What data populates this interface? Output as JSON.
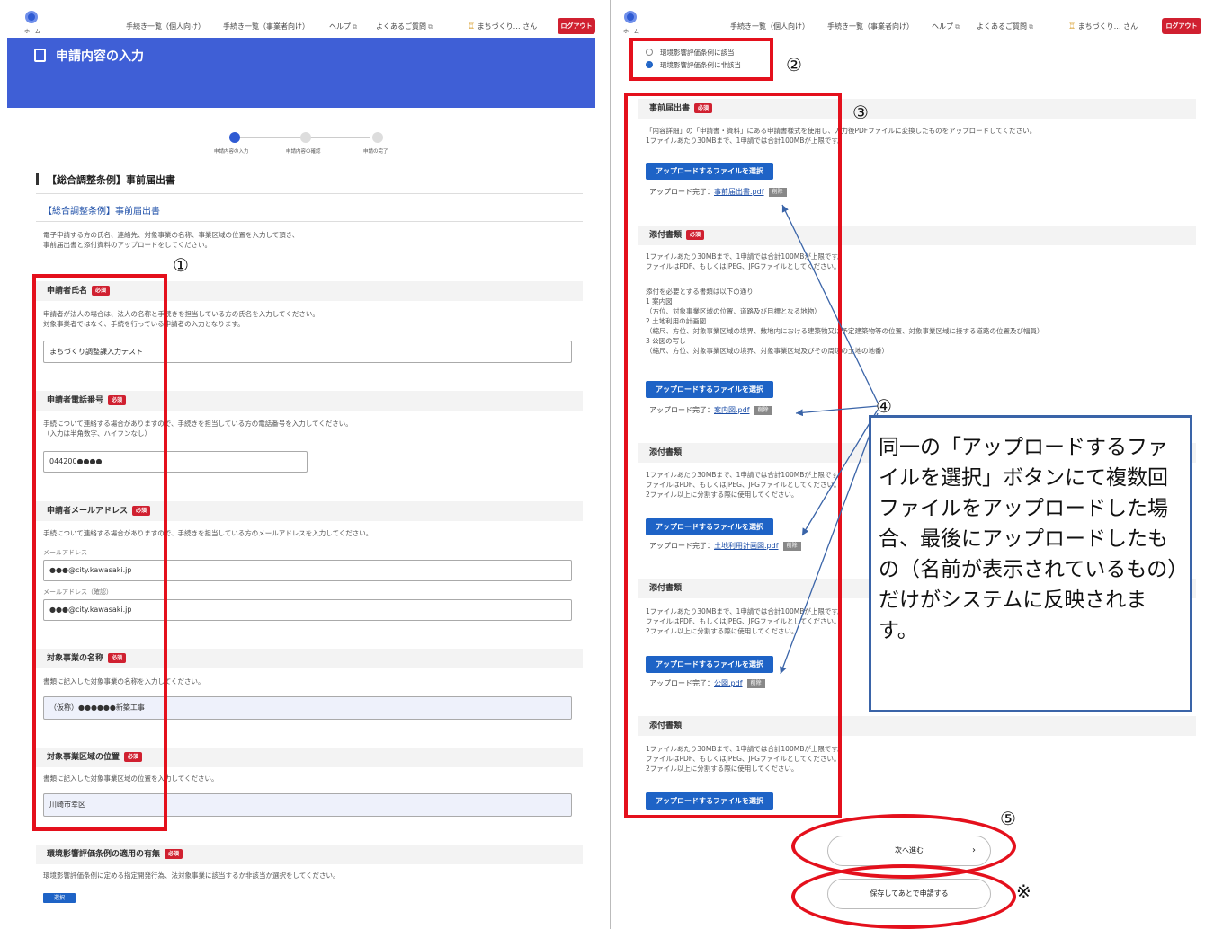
{
  "header": {
    "home_label": "ホーム",
    "links": [
      "手続き一覧（個人向け）",
      "手続き一覧（事業者向け）",
      "ヘルプ",
      "よくあるご質問"
    ],
    "user": "まちづくり… さん",
    "logout": "ログアウト"
  },
  "left": {
    "page_title": "申請内容の入力",
    "steps": [
      "申請内容の入力",
      "申請内容の確認",
      "申請の完了"
    ],
    "form_title": "【総合調整条例】事前届出書",
    "sub_title": "【総合調整条例】事前届出書",
    "intro": "電子申請する方の氏名、連絡先、対象事業の名称、事業区域の位置を入力して頂き、\n事前届出書と添付資料のアップロードをしてください。",
    "fields": [
      {
        "label": "申請者氏名",
        "help": "申請者が法人の場合は、法人の名称と手続きを担当している方の氏名を入力してください。\n対象事業者ではなく、手続を行っている申請者の入力となります。",
        "value": "まちづくり調整課入力テスト"
      },
      {
        "label": "申請者電話番号",
        "help": "手続について連絡する場合がありますので、手続きを担当している方の電話番号を入力してください。\n（入力は半角数字、ハイフンなし）",
        "value": "044200●●●●"
      },
      {
        "label": "申請者メールアドレス",
        "help": "手続について連絡する場合がありますので、手続きを担当している方のメールアドレスを入力してください。",
        "sub1": "メールアドレス",
        "value1": "●●●@city.kawasaki.jp",
        "sub2": "メールアドレス（確認）",
        "value2": "●●●@city.kawasaki.jp"
      },
      {
        "label": "対象事業の名称",
        "help": "書類に記入した対象事業の名称を入力してください。",
        "value": "（仮称）●●●●●●新築工事"
      },
      {
        "label": "対象事業区域の位置",
        "help": "書類に記入した対象事業区域の位置を入力してください。",
        "value": "川崎市幸区"
      },
      {
        "label": "環境影響評価条例の適用の有無",
        "help": "環境影響評価条例に定める指定開発行為、法対象事業に該当するか非該当か選択をしてください。",
        "button": "選択"
      }
    ],
    "required": "必須"
  },
  "right": {
    "radios": [
      "環境影響評価条例に該当",
      "環境影響評価条例に非該当"
    ],
    "sections": [
      {
        "title": "事前届出書",
        "required": true,
        "help": "「内容詳細」の「申請書・資料」にある申請書様式を使用し、入力後PDFファイルに変換したものをアップロードしてください。\n1ファイルあたり30MBまで、1申請では合計100MBが上限です。",
        "upload": "アップロードするファイルを選択",
        "done": "アップロード完了：",
        "file": "事前届出書.pdf",
        "del": "削除"
      },
      {
        "title": "添付書類",
        "required": true,
        "help": "1ファイルあたり30MBまで、1申請では合計100MBが上限です。\nファイルはPDF、もしくはJPEG、JPGファイルとしてください。",
        "help2": "添付を必要とする書類は以下の通り\n1 案内図\n（方位、対象事業区域の位置、道路及び目標となる地物）\n2 土地利用の計画図\n（縮尺、方位、対象事業区域の境界、敷地内における建築物又は予定建築物等の位置、対象事業区域に接する道路の位置及び幅員）\n3 公図の写し\n（縮尺、方位、対象事業区域の境界、対象事業区域及びその周辺の土地の地番）",
        "upload": "アップロードするファイルを選択",
        "done": "アップロード完了：",
        "file": "案内図.pdf",
        "del": "削除"
      },
      {
        "title": "添付書類",
        "required": false,
        "help": "1ファイルあたり30MBまで、1申請では合計100MBが上限です。\nファイルはPDF、もしくはJPEG、JPGファイルとしてください。\n2ファイル以上に分割する際に使用してください。",
        "upload": "アップロードするファイルを選択",
        "done": "アップロード完了：",
        "file": "土地利用計画図.pdf",
        "del": "削除"
      },
      {
        "title": "添付書類",
        "required": false,
        "help": "1ファイルあたり30MBまで、1申請では合計100MBが上限です。\nファイルはPDF、もしくはJPEG、JPGファイルとしてください。\n2ファイル以上に分割する際に使用してください。",
        "upload": "アップロードするファイルを選択",
        "done": "アップロード完了：",
        "file": "公図.pdf",
        "del": "削除"
      },
      {
        "title": "添付書類",
        "required": false,
        "help": "1ファイルあたり30MBまで、1申請では合計100MBが上限です。\nファイルはPDF、もしくはJPEG、JPGファイルとしてください。\n2ファイル以上に分割する際に使用してください。",
        "upload": "アップロードするファイルを選択"
      }
    ],
    "next": "次へ進む",
    "save": "保存してあとで申請する"
  },
  "annotations": {
    "n1": "①",
    "n2": "②",
    "n3": "③",
    "n4": "④",
    "n5": "⑤",
    "note_mark": "※",
    "callout": "同一の「アップロードするファイルを選択」ボタンにて複数回ファイルをアップロードした場合、最後にアップロードしたもの（名前が表示されているもの）だけがシステムに反映されます。"
  },
  "colors": {
    "banner": "#3f5fd6",
    "accent": "#1e63c6",
    "annotation": "#e4101c",
    "callout_border": "#3a64a8"
  }
}
